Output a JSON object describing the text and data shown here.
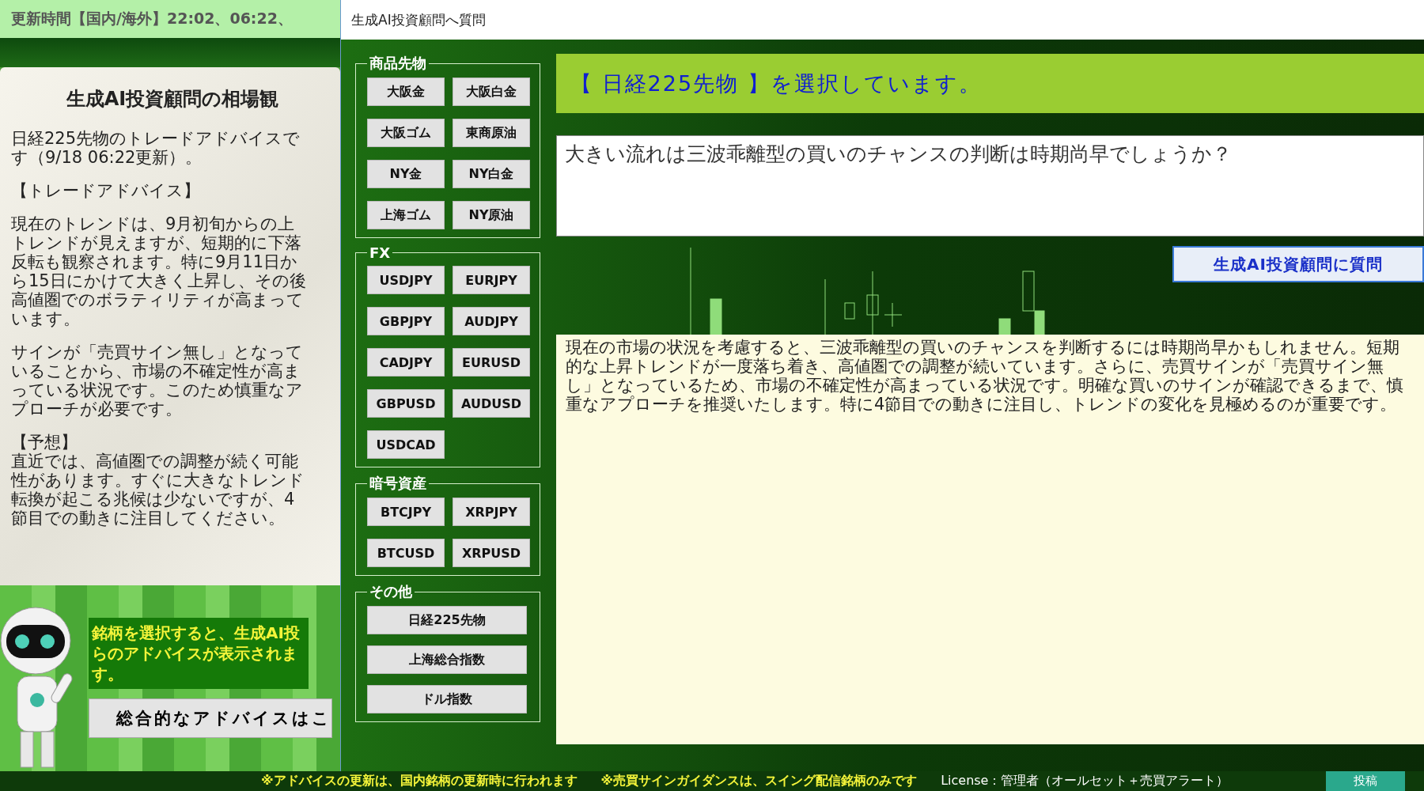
{
  "app": {
    "update_time": "更新時間【国内/海外】22:02、06:22、",
    "market_view": {
      "title": "生成AI投資顧問の相場観",
      "paragraphs": [
        "日経225先物のトレードアドバイスです（9/18 06:22更新）。",
        "【トレードアドバイス】",
        "現在のトレンドは、9月初旬からの上トレンドが見えますが、短期的に下落反転も観察されます。特に9月11日から15日にかけて大きく上昇し、その後高値圏でのボラティリティが高まっています。",
        "サインが「売買サイン無し」となっていることから、市場の不確定性が高まっている状況です。このため慎重なアプローチが必要です。",
        "【予想】",
        "直近では、高値圏での調整が続く可能性があります。すぐに大きなトレンド転換が起こる兆候は少ないですが、4節目での動きに注目してください。"
      ]
    },
    "hint": "銘柄を選択すると、生成AI投らのアドバイスが表示されます。",
    "overall_button": "総合的なアドバイスはこ"
  },
  "dialog": {
    "title": "生成AI投資顧問へ質問",
    "groups": [
      {
        "label": "商品先物",
        "kind": "pair",
        "buttons": [
          "大阪金",
          "大阪白金",
          "大阪ゴム",
          "東商原油",
          "NY金",
          "NY白金",
          "上海ゴム",
          "NY原油"
        ]
      },
      {
        "label": "FX",
        "kind": "pair",
        "buttons": [
          "USDJPY",
          "EURJPY",
          "GBPJPY",
          "AUDJPY",
          "CADJPY",
          "EURUSD",
          "GBPUSD",
          "AUDUSD",
          "USDCAD"
        ]
      },
      {
        "label": "暗号資産",
        "kind": "pair",
        "buttons": [
          "BTCJPY",
          "XRPJPY",
          "BTCUSD",
          "XRPUSD"
        ]
      },
      {
        "label": "その他",
        "kind": "wide",
        "buttons": [
          "日経225先物",
          "上海総合指数",
          "ドル指数"
        ]
      }
    ],
    "selection_banner": "【 日経225先物 】を選択しています。",
    "question": {
      "value": "大きい流れは三波乖離型の買いのチャンスの判断は時期尚早でしょうか？"
    },
    "ask_button": "生成AI投資顧問に質問",
    "answer": "現在の市場の状況を考慮すると、三波乖離型の買いのチャンスを判断するには時期尚早かもしれません。短期的な上昇トレンドが一度落ち着き、高値圏での調整が続いています。さらに、売買サインが「売買サイン無し」となっているため、市場の不確定性が高まっている状況です。明確な買いのサインが確認できるまで、慎重なアプローチを推奨いたします。特に4節目での動きに注目し、トレンドの変化を見極めるのが重要です。"
  },
  "status_bar": {
    "notes": [
      "※アドバイスの更新は、国内銘柄の更新時に行われます",
      "※売買サインガイダンスは、スイング配信銘柄のみです"
    ],
    "license": "License：管理者（オールセット＋売買アラート）",
    "post_button": "投稿"
  }
}
